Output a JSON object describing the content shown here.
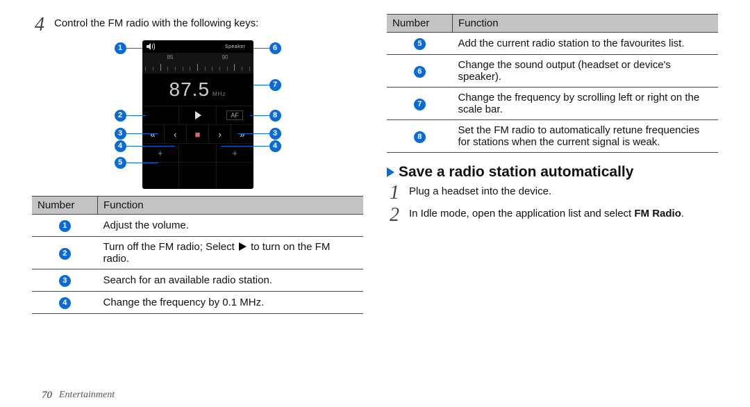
{
  "page_number": "70",
  "chapter": "Entertainment",
  "left": {
    "step4_num": "4",
    "step4_text": "Control the FM radio with the following keys:",
    "table_header_num": "Number",
    "table_header_func": "Function",
    "rows": [
      {
        "n": "1",
        "f": "Adjust the volume."
      },
      {
        "n": "2",
        "f_pre": "Turn off the FM radio; Select ",
        "f_post": " to turn on the FM radio."
      },
      {
        "n": "3",
        "f": "Search for an available radio station."
      },
      {
        "n": "4",
        "f": "Change the frequency by 0.1 MHz."
      }
    ],
    "screen": {
      "speaker_label": "Speaker",
      "tuner_left": "85",
      "tuner_right": "90",
      "freq": "87.5",
      "freq_unit": "MHz",
      "af": "AF"
    }
  },
  "right": {
    "table_header_num": "Number",
    "table_header_func": "Function",
    "rows": [
      {
        "n": "5",
        "f": "Add the current radio station to the favourites list."
      },
      {
        "n": "6",
        "f": "Change the sound output (headset or device's speaker)."
      },
      {
        "n": "7",
        "f": "Change the frequency by scrolling left or right on the scale bar."
      },
      {
        "n": "8",
        "f": "Set the FM radio to automatically retune frequencies for stations when the current signal is weak."
      }
    ],
    "heading": "Save a radio station automatically",
    "steps": [
      {
        "n": "1",
        "t": "Plug a headset into the device."
      },
      {
        "n": "2",
        "t_pre": "In Idle mode, open the application list and select ",
        "bold1": "FM Radio",
        "t_post": "."
      }
    ]
  },
  "callouts": {
    "left": [
      "1",
      "2",
      "3",
      "4",
      "5"
    ],
    "right": [
      "6",
      "7",
      "8",
      "3",
      "4"
    ]
  }
}
